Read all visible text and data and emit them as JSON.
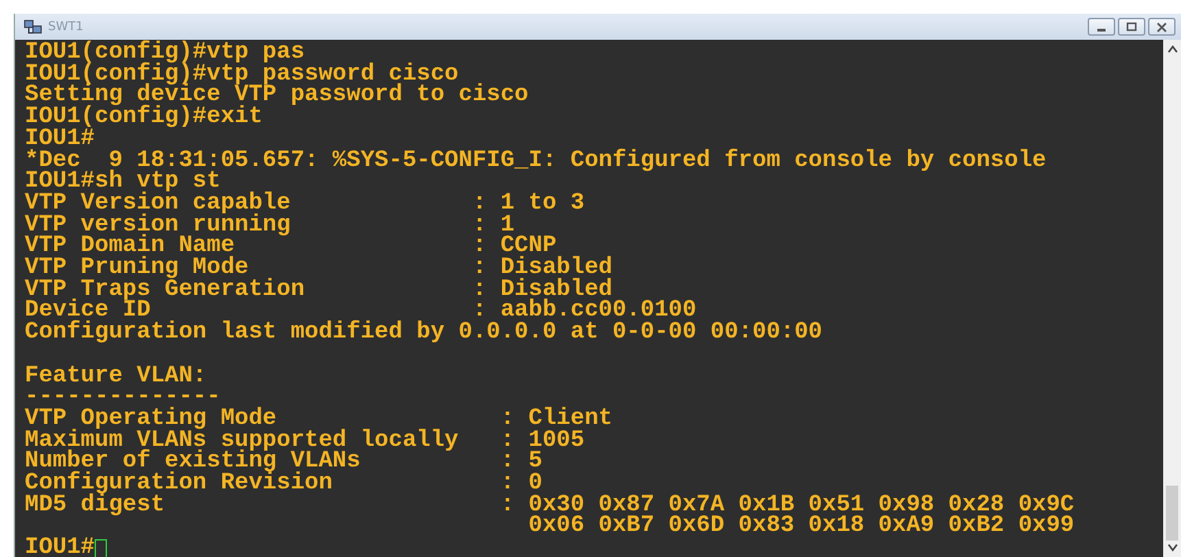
{
  "window": {
    "title": "SWT1"
  },
  "terminal": {
    "lines": [
      {
        "kind": "text",
        "text": "IOU1(config)#vtp pas"
      },
      {
        "kind": "text",
        "text": "IOU1(config)#vtp password cisco"
      },
      {
        "kind": "text",
        "text": "Setting device VTP password to cisco"
      },
      {
        "kind": "text",
        "text": "IOU1(config)#exit"
      },
      {
        "kind": "text",
        "text": "IOU1#"
      },
      {
        "kind": "text",
        "text": "*Dec  9 18:31:05.657: %SYS-5-CONFIG_I: Configured from console by console"
      },
      {
        "kind": "text",
        "text": "IOU1#sh vtp st"
      },
      {
        "kind": "text",
        "text": "VTP Version capable             : 1 to 3"
      },
      {
        "kind": "text",
        "text": "VTP version running             : 1"
      },
      {
        "kind": "text",
        "text": "VTP Domain Name                 : CCNP"
      },
      {
        "kind": "text",
        "text": "VTP Pruning Mode                : Disabled"
      },
      {
        "kind": "text",
        "text": "VTP Traps Generation            : Disabled"
      },
      {
        "kind": "text",
        "text": "Device ID                       : aabb.cc00.0100"
      },
      {
        "kind": "text",
        "text": "Configuration last modified by 0.0.0.0 at 0-0-00 00:00:00"
      },
      {
        "kind": "blank"
      },
      {
        "kind": "text",
        "text": "Feature VLAN:"
      },
      {
        "kind": "text",
        "text": "--------------"
      },
      {
        "kind": "text",
        "text": "VTP Operating Mode                : Client"
      },
      {
        "kind": "text",
        "text": "Maximum VLANs supported locally   : 1005"
      },
      {
        "kind": "text",
        "text": "Number of existing VLANs          : 5"
      },
      {
        "kind": "text",
        "text": "Configuration Revision            : 0"
      },
      {
        "kind": "text",
        "text": "MD5 digest                        : 0x30 0x87 0x7A 0x1B 0x51 0x98 0x28 0x9C"
      },
      {
        "kind": "text",
        "text": "                                    0x06 0xB7 0x6D 0x83 0x18 0xA9 0xB2 0x99"
      }
    ],
    "prompt": "IOU1#"
  }
}
